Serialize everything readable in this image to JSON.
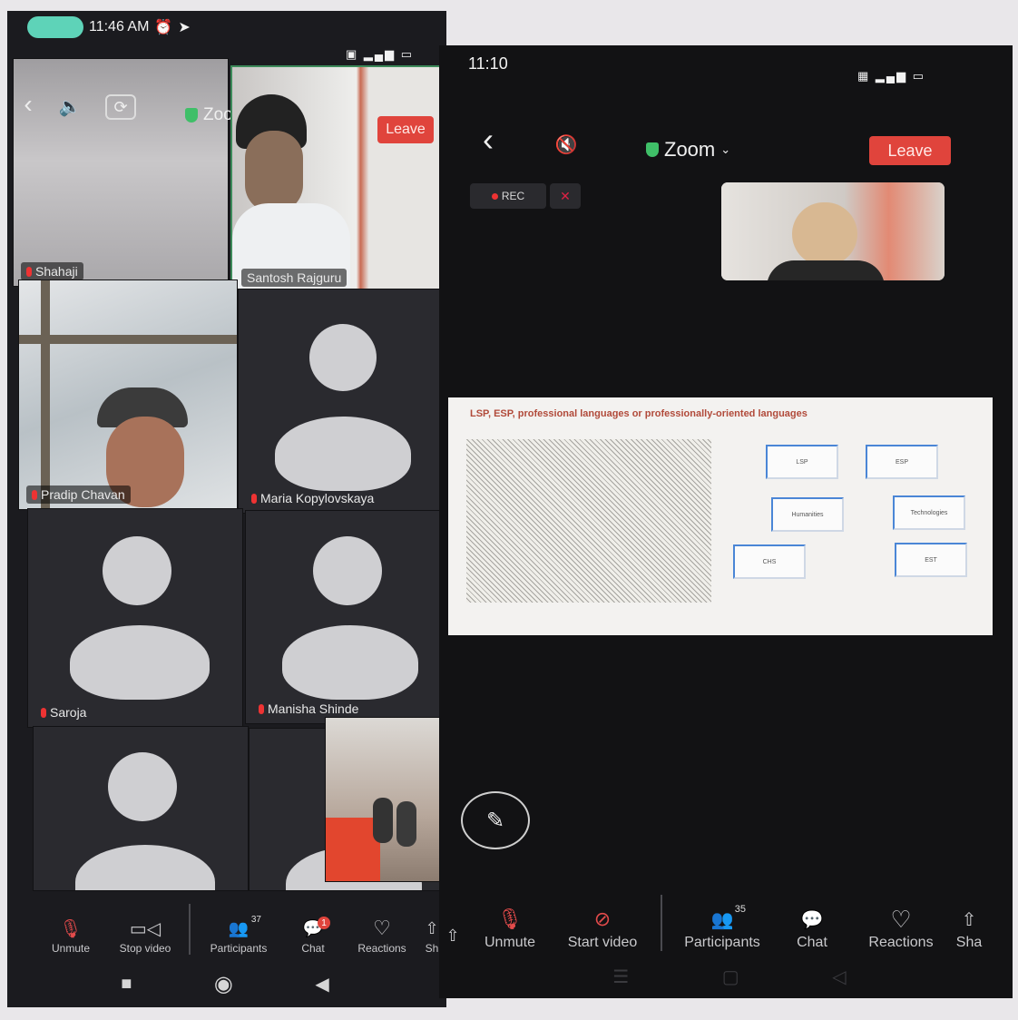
{
  "left_phone": {
    "status": {
      "time": "11:46 AM"
    },
    "top_bar": {
      "app_title": "Zoom",
      "leave_label": "Leave"
    },
    "tiles": [
      {
        "name": "Shahaji"
      },
      {
        "name": "Santosh Rajguru"
      },
      {
        "name": "Pradip Chavan"
      },
      {
        "name": "Maria Kopylovskaya"
      },
      {
        "name": "Saroja"
      },
      {
        "name": "Manisha Shinde"
      }
    ],
    "toolbar": [
      {
        "label": "Unmute",
        "icon": "mic-off-icon"
      },
      {
        "label": "Stop video",
        "icon": "video-icon"
      },
      {
        "label": "Participants",
        "icon": "participants-icon",
        "count": "37"
      },
      {
        "label": "Chat",
        "icon": "chat-icon",
        "badge": "1"
      },
      {
        "label": "Reactions",
        "icon": "heart-icon"
      },
      {
        "label": "Sh",
        "icon": "share-icon"
      }
    ]
  },
  "right_phone": {
    "status": {
      "time": "11:10"
    },
    "top_bar": {
      "app_title": "Zoom",
      "leave_label": "Leave",
      "rec_label": "REC"
    },
    "slide": {
      "title": "LSP, ESP, professional languages or professionally-oriented languages",
      "boxes": [
        "LSP",
        "ESP",
        "Humanities",
        "Technologies",
        "CHS",
        "EST"
      ]
    },
    "toolbar": [
      {
        "label": "Unmute",
        "icon": "mic-off-icon"
      },
      {
        "label": "Start video",
        "icon": "video-off-icon"
      },
      {
        "label": "Participants",
        "icon": "participants-icon",
        "count": "35"
      },
      {
        "label": "Chat",
        "icon": "chat-icon"
      },
      {
        "label": "Reactions",
        "icon": "heart-icon"
      },
      {
        "label": "Sha",
        "icon": "share-icon"
      }
    ]
  },
  "colors": {
    "leave": "#e0443c",
    "shield": "#3fbf68",
    "mic_muted": "#e33333",
    "active_border": "#3d8a5a"
  }
}
